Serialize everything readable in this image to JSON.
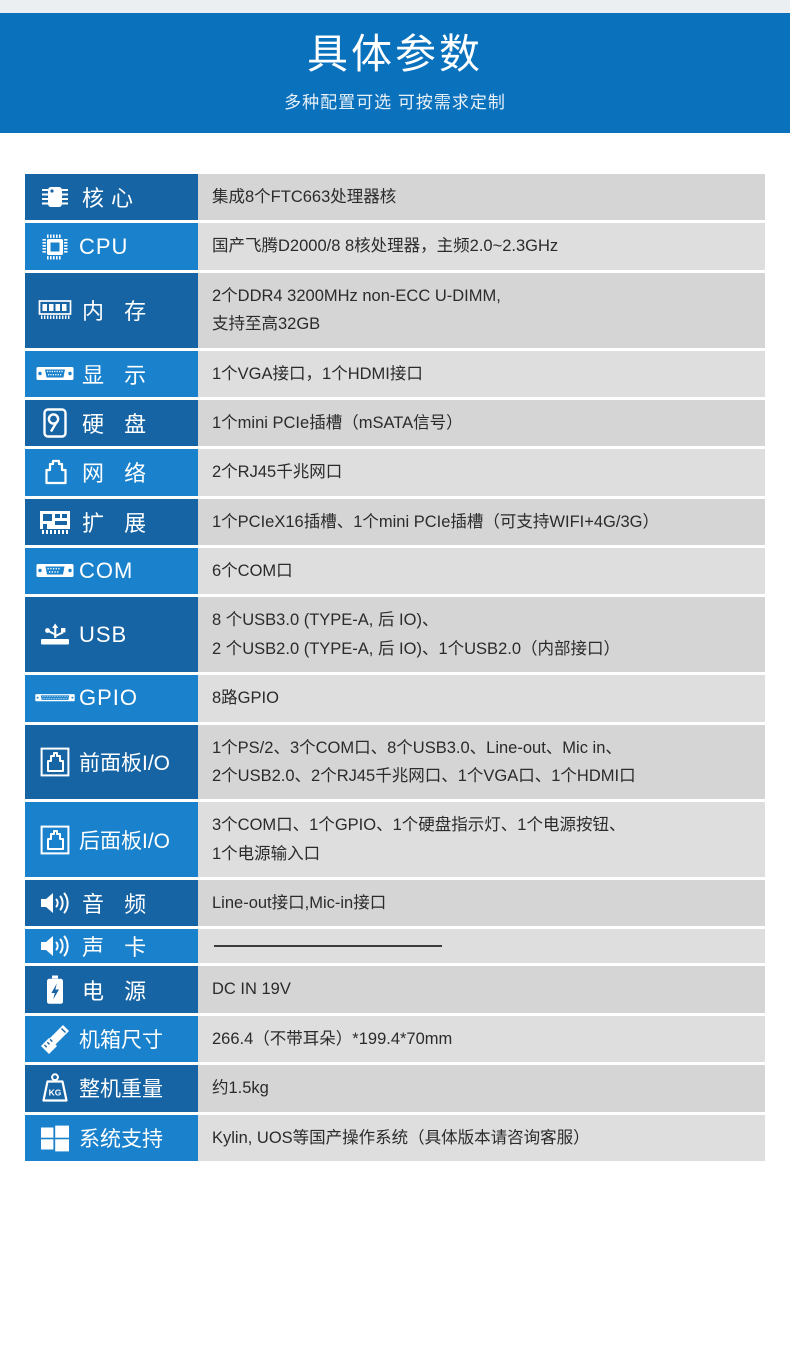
{
  "banner": {
    "title": "具体参数",
    "subtitle": "多种配置可选 可按需求定制",
    "bg_color": "#0a71bd"
  },
  "colors": {
    "label_dark": "#1664a4",
    "label_light": "#1a82cd",
    "value_gray_a": "#d5d5d5",
    "value_gray_b": "#dedede",
    "top_strip": "#eceff1"
  },
  "spec_table": {
    "rows": [
      {
        "icon": "chip-icon",
        "label": "核心",
        "lines": [
          "集成8个FTC663处理器核"
        ]
      },
      {
        "icon": "cpu-icon",
        "label": "CPU",
        "lines": [
          "国产飞腾D2000/8  8核处理器，主频2.0~2.3GHz"
        ]
      },
      {
        "icon": "memory-dimm-icon",
        "label": "内 存",
        "lines": [
          "2个DDR4 3200MHz non-ECC U-DIMM,",
          "支持至高32GB"
        ]
      },
      {
        "icon": "vga-port-icon",
        "label": "显 示",
        "lines": [
          "1个VGA接口，1个HDMI接口"
        ]
      },
      {
        "icon": "harddisk-icon",
        "label": "硬 盘",
        "lines": [
          "1个mini PCIe插槽（mSATA信号）"
        ]
      },
      {
        "icon": "rj45-network-icon",
        "label": "网 络",
        "lines": [
          "2个RJ45千兆网口"
        ]
      },
      {
        "icon": "expansion-card-icon",
        "label": "扩 展",
        "lines": [
          "1个PCIeX16插槽、1个mini PCIe插槽（可支持WIFI+4G/3G）"
        ]
      },
      {
        "icon": "com-port-icon",
        "label": "COM",
        "lines": [
          "6个COM口"
        ]
      },
      {
        "icon": "usb-icon",
        "label": "USB",
        "lines": [
          "8 个USB3.0 (TYPE-A, 后 IO)、",
          "2 个USB2.0 (TYPE-A, 后 IO)、1个USB2.0（内部接口）"
        ]
      },
      {
        "icon": "gpio-connector-icon",
        "label": "GPIO",
        "lines": [
          "8路GPIO"
        ]
      },
      {
        "icon": "front-panel-icon",
        "label": "前面板I/O",
        "lines": [
          "1个PS/2、3个COM口、8个USB3.0、Line-out、Mic in、",
          "2个USB2.0、2个RJ45千兆网口、1个VGA口、1个HDMI口"
        ]
      },
      {
        "icon": "rear-panel-icon",
        "label": "后面板I/O",
        "lines": [
          "3个COM口、1个GPIO、1个硬盘指示灯、1个电源按钮、",
          "1个电源输入口"
        ]
      },
      {
        "icon": "speaker-icon",
        "label": "音 频",
        "lines": [
          "Line-out接口,Mic-in接口"
        ]
      },
      {
        "icon": "speaker-icon",
        "label": "声 卡",
        "lines": [
          "—"
        ],
        "is_dash": true
      },
      {
        "icon": "battery-power-icon",
        "label": "电 源",
        "lines": [
          "DC IN 19V"
        ]
      },
      {
        "icon": "ruler-pencil-icon",
        "label": "机箱尺寸",
        "lines": [
          "266.4（不带耳朵）*199.4*70mm"
        ]
      },
      {
        "icon": "weight-kg-icon",
        "label": "整机重量",
        "lines": [
          "约1.5kg"
        ]
      },
      {
        "icon": "windows-logo-icon",
        "label": "系统支持",
        "lines": [
          "Kylin, UOS等国产操作系统（具体版本请咨询客服）"
        ]
      }
    ]
  }
}
